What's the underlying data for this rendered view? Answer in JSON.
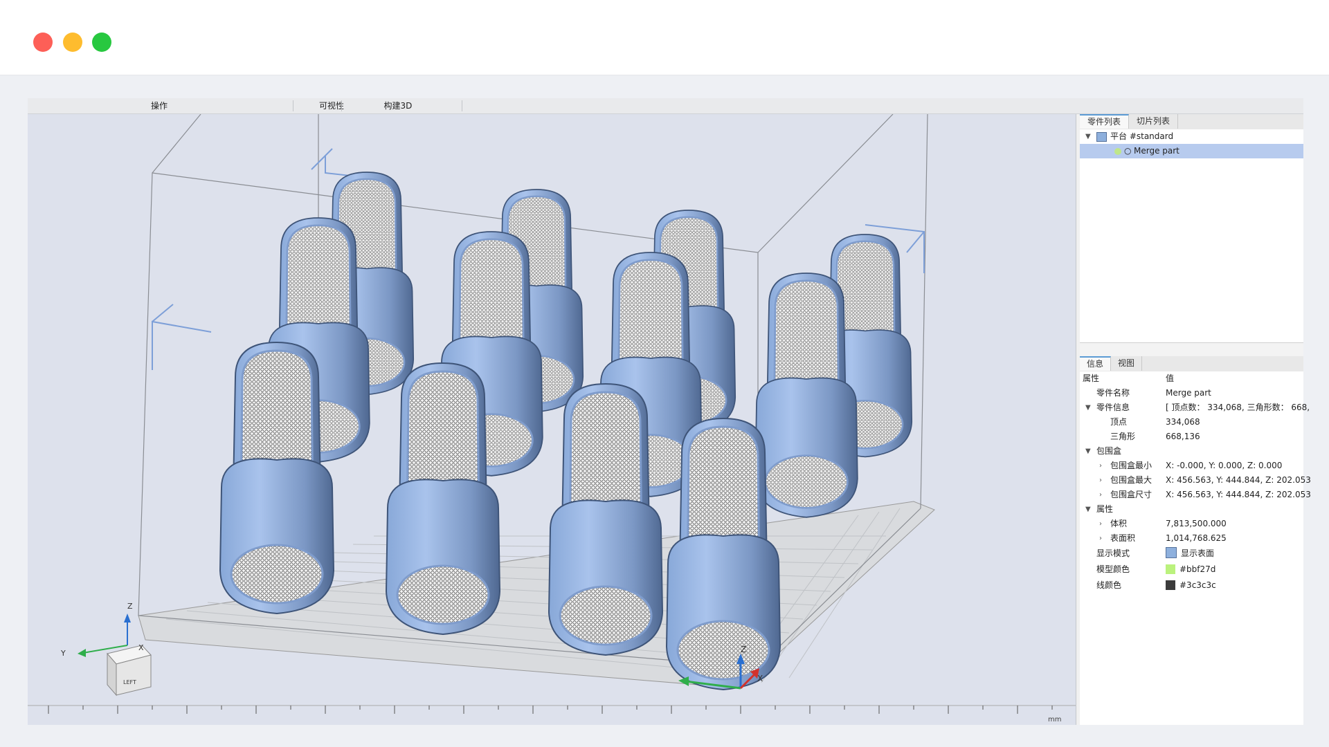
{
  "window": {
    "traffic_lights": {
      "close": "#fd5f57",
      "minimize": "#febc2e",
      "maximize": "#28c840"
    }
  },
  "menu": {
    "items": [
      "操作",
      "可视性",
      "构建3D"
    ]
  },
  "viewport": {
    "axis_labels": {
      "z": "Z",
      "x": "X",
      "y": "Y"
    },
    "view_cube_label": "LEFT",
    "ruler_unit": "mm",
    "model_color": "#9fb8dc"
  },
  "panel": {
    "top_tabs": [
      "零件列表",
      "切片列表"
    ],
    "tree": {
      "platform_label": "平台 #standard",
      "part_label": "Merge part"
    },
    "bottom_tabs": [
      "信息",
      "视图"
    ],
    "properties": {
      "header_name": "属性",
      "header_value": "值",
      "part_name_label": "零件名称",
      "part_name_value": "Merge part",
      "part_info_label": "零件信息",
      "part_info_value": "[ 顶点数： 334,068, 三角形数： 668,",
      "vertices_label": "顶点",
      "vertices_value": "334,068",
      "triangles_label": "三角形",
      "triangles_value": "668,136",
      "bbox_label": "包围盒",
      "bbox_min_label": "包围盒最小",
      "bbox_min_value": "X: -0.000, Y: 0.000, Z: 0.000",
      "bbox_max_label": "包围盒最大",
      "bbox_max_value": "X: 456.563, Y: 444.844, Z: 202.053",
      "bbox_size_label": "包围盒尺寸",
      "bbox_size_value": "X: 456.563, Y: 444.844, Z: 202.053",
      "attr_label": "属性",
      "volume_label": "体积",
      "volume_value": "7,813,500.000",
      "area_label": "表面积",
      "area_value": "1,014,768.625",
      "display_mode_label": "显示模式",
      "display_mode_value": "显示表面",
      "model_color_label": "模型颜色",
      "model_color_value": "#bbf27d",
      "line_color_label": "线颜色",
      "line_color_value": "#3c3c3c"
    }
  }
}
